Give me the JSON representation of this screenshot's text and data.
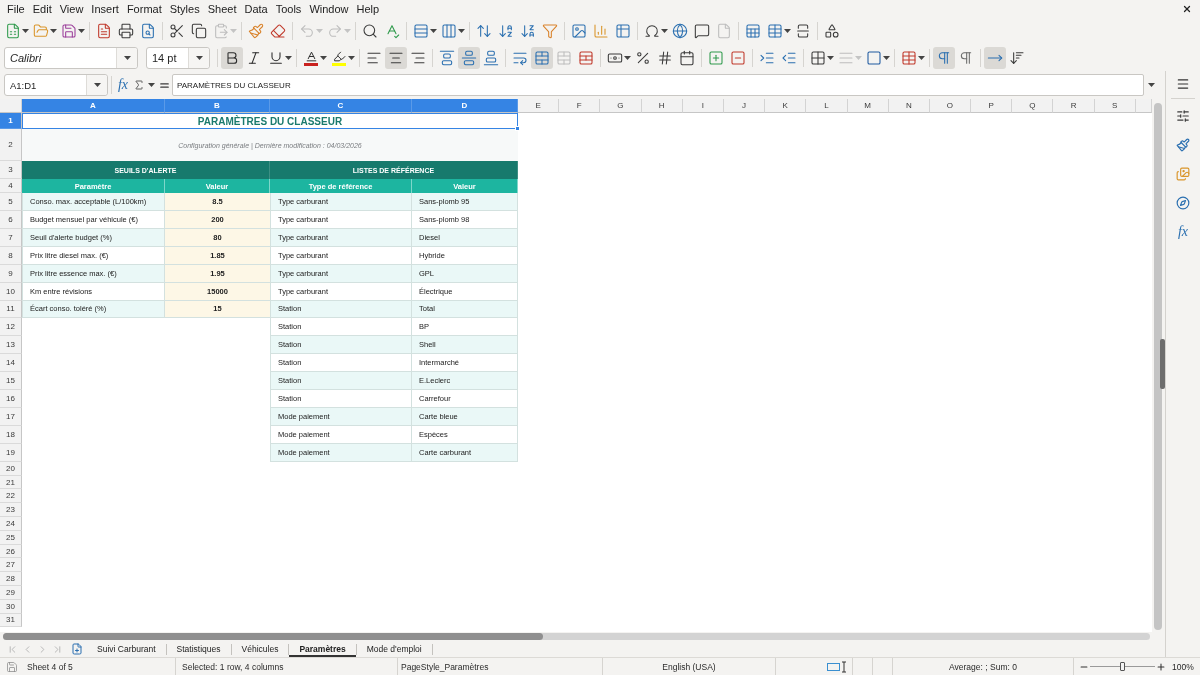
{
  "menu_bar": {
    "items": [
      "File",
      "Edit",
      "View",
      "Insert",
      "Format",
      "Styles",
      "Sheet",
      "Data",
      "Tools",
      "Window",
      "Help"
    ]
  },
  "standard_toolbar": {
    "groups": [
      {
        "buttons": [
          {
            "kind": "new",
            "disabled": false
          },
          {
            "kind": "open",
            "disabled": false
          },
          {
            "kind": "save",
            "disabled": false
          }
        ]
      },
      {
        "buttons": [
          {
            "kind": "pdf",
            "disabled": false
          },
          {
            "kind": "print",
            "disabled": false
          },
          {
            "kind": "preview",
            "disabled": false
          }
        ]
      },
      {
        "buttons": [
          {
            "kind": "cut",
            "disabled": false
          },
          {
            "kind": "copy",
            "disabled": false
          },
          {
            "kind": "paste",
            "disabled": true
          }
        ]
      },
      {
        "buttons": [
          {
            "kind": "brush",
            "disabled": false
          },
          {
            "kind": "eraser",
            "disabled": false
          }
        ]
      },
      {
        "buttons": [
          {
            "kind": "undo",
            "disabled": true
          },
          {
            "kind": "redo",
            "disabled": true
          }
        ]
      },
      {
        "buttons": [
          {
            "kind": "find",
            "disabled": false
          },
          {
            "kind": "spelling",
            "disabled": false
          }
        ]
      },
      {
        "buttons": [
          {
            "kind": "rows",
            "disabled": false
          },
          {
            "kind": "columns",
            "disabled": false
          }
        ]
      },
      {
        "buttons": [
          {
            "kind": "sort",
            "disabled": false
          },
          {
            "kind": "ascending",
            "disabled": false
          },
          {
            "kind": "descending",
            "disabled": false
          },
          {
            "kind": "filter",
            "disabled": false
          }
        ]
      },
      {
        "buttons": [
          {
            "kind": "image",
            "disabled": false
          },
          {
            "kind": "chart",
            "disabled": false
          },
          {
            "kind": "pivot",
            "disabled": false
          }
        ]
      },
      {
        "buttons": [
          {
            "kind": "symbol",
            "disabled": false
          },
          {
            "kind": "link",
            "disabled": false
          },
          {
            "kind": "comment",
            "disabled": false
          },
          {
            "kind": "header",
            "disabled": true
          }
        ]
      },
      {
        "buttons": [
          {
            "kind": "printarea",
            "disabled": false
          },
          {
            "kind": "freeze",
            "disabled": false
          },
          {
            "kind": "split",
            "disabled": false
          }
        ]
      },
      {
        "buttons": [
          {
            "kind": "shapes",
            "disabled": false
          }
        ]
      }
    ]
  },
  "format_toolbar": {
    "font_name": "Calibri",
    "font_size": "14 pt",
    "groups": [
      {
        "buttons": [
          {
            "kind": "bold",
            "pressed": true,
            "disabled": false
          },
          {
            "kind": "italic",
            "pressed": false,
            "disabled": false
          },
          {
            "kind": "underline",
            "pressed": false,
            "disabled": false
          }
        ]
      },
      {
        "buttons": [
          {
            "kind": "fontcolor",
            "pressed": false,
            "disabled": false
          },
          {
            "kind": "highlight",
            "pressed": false,
            "disabled": false
          }
        ]
      },
      {
        "buttons": [
          {
            "kind": "alignleft",
            "pressed": false,
            "disabled": false
          },
          {
            "kind": "aligncenter",
            "pressed": true,
            "disabled": false
          },
          {
            "kind": "alignright",
            "pressed": false,
            "disabled": false
          }
        ]
      },
      {
        "buttons": [
          {
            "kind": "aligntop",
            "pressed": false,
            "disabled": false
          },
          {
            "kind": "alignmiddle",
            "pressed": true,
            "disabled": false
          },
          {
            "kind": "alignbottom",
            "pressed": false,
            "disabled": false
          }
        ]
      },
      {
        "buttons": [
          {
            "kind": "wrap",
            "pressed": false,
            "disabled": false
          },
          {
            "kind": "mergecenter",
            "pressed": true,
            "disabled": false
          },
          {
            "kind": "merge",
            "pressed": false,
            "disabled": true
          },
          {
            "kind": "unmerge",
            "pressed": false,
            "disabled": false
          }
        ]
      },
      {
        "buttons": [
          {
            "kind": "currency",
            "pressed": false,
            "disabled": false
          },
          {
            "kind": "percent",
            "pressed": false,
            "disabled": false
          },
          {
            "kind": "number",
            "pressed": false,
            "disabled": false
          },
          {
            "kind": "date",
            "pressed": false,
            "disabled": false
          }
        ]
      },
      {
        "buttons": [
          {
            "kind": "adddecimal",
            "pressed": false,
            "disabled": false
          },
          {
            "kind": "deldecimal",
            "pressed": false,
            "disabled": false
          }
        ]
      },
      {
        "buttons": [
          {
            "kind": "indent",
            "pressed": false,
            "disabled": false
          },
          {
            "kind": "outdent",
            "pressed": false,
            "disabled": false
          }
        ]
      },
      {
        "buttons": [
          {
            "kind": "borders",
            "pressed": false,
            "disabled": false
          },
          {
            "kind": "borderstyle",
            "pressed": false,
            "disabled": true
          },
          {
            "kind": "bordercolor",
            "pressed": false,
            "disabled": false
          }
        ]
      },
      {
        "buttons": [
          {
            "kind": "conditional",
            "pressed": false,
            "disabled": false
          }
        ]
      },
      {
        "buttons": [
          {
            "kind": "ltr",
            "pressed": true,
            "disabled": false
          },
          {
            "kind": "rtl",
            "pressed": false,
            "disabled": false
          }
        ]
      },
      {
        "buttons": [
          {
            "kind": "horizontal",
            "pressed": true,
            "disabled": false
          },
          {
            "kind": "vertical",
            "pressed": false,
            "disabled": false
          }
        ]
      }
    ]
  },
  "formula_bar": {
    "name_box": "A1:D1",
    "function_wizard": "fx",
    "content": "PARAMÈTRES DU CLASSEUR"
  },
  "sidebar": {
    "functions": "fx"
  },
  "sheet": {
    "column_headers": [
      {
        "label": "A",
        "selected": true
      },
      {
        "label": "B",
        "selected": true
      },
      {
        "label": "C",
        "selected": true
      },
      {
        "label": "D",
        "selected": true
      },
      {
        "label": "E",
        "selected": false
      },
      {
        "label": "F",
        "selected": false
      },
      {
        "label": "G",
        "selected": false
      },
      {
        "label": "H",
        "selected": false
      },
      {
        "label": "I",
        "selected": false
      },
      {
        "label": "J",
        "selected": false
      },
      {
        "label": "K",
        "selected": false
      },
      {
        "label": "L",
        "selected": false
      },
      {
        "label": "M",
        "selected": false
      },
      {
        "label": "N",
        "selected": false
      },
      {
        "label": "O",
        "selected": false
      },
      {
        "label": "P",
        "selected": false
      },
      {
        "label": "Q",
        "selected": false
      },
      {
        "label": "R",
        "selected": false
      },
      {
        "label": "S",
        "selected": false
      }
    ],
    "row_headers": [
      {
        "label": "1",
        "selected": true
      },
      {
        "label": "2",
        "selected": false
      },
      {
        "label": "3",
        "selected": false
      },
      {
        "label": "4",
        "selected": false
      },
      {
        "label": "5",
        "selected": false
      },
      {
        "label": "6",
        "selected": false
      },
      {
        "label": "7",
        "selected": false
      },
      {
        "label": "8",
        "selected": false
      },
      {
        "label": "9",
        "selected": false
      },
      {
        "label": "10",
        "selected": false
      },
      {
        "label": "11",
        "selected": false
      },
      {
        "label": "12",
        "selected": false
      },
      {
        "label": "13",
        "selected": false
      },
      {
        "label": "14",
        "selected": false
      },
      {
        "label": "15",
        "selected": false
      },
      {
        "label": "16",
        "selected": false
      },
      {
        "label": "17",
        "selected": false
      },
      {
        "label": "18",
        "selected": false
      },
      {
        "label": "19",
        "selected": false
      },
      {
        "label": "20",
        "selected": false
      },
      {
        "label": "21",
        "selected": false
      },
      {
        "label": "22",
        "selected": false
      },
      {
        "label": "23",
        "selected": false
      },
      {
        "label": "24",
        "selected": false
      },
      {
        "label": "25",
        "selected": false
      },
      {
        "label": "26",
        "selected": false
      },
      {
        "label": "27",
        "selected": false
      },
      {
        "label": "28",
        "selected": false
      },
      {
        "label": "29",
        "selected": false
      },
      {
        "label": "30",
        "selected": false
      },
      {
        "label": "31",
        "selected": false
      }
    ],
    "title": {
      "text": "PARAMÈTRES DU CLASSEUR",
      "selected": true
    },
    "subtitle": "Configuration générale | Dernière modification : 04/03/2026",
    "alert_thresholds": {
      "heading": "SEUILS D'ALERTE",
      "columns": [
        "Paramètre",
        "Valeur"
      ],
      "rows": [
        {
          "parameter": "Conso. max. acceptable (L/100km)",
          "value": "8.5"
        },
        {
          "parameter": "Budget mensuel par véhicule (€)",
          "value": "200"
        },
        {
          "parameter": "Seuil d'alerte budget (%)",
          "value": "80"
        },
        {
          "parameter": "Prix litre diesel max. (€)",
          "value": "1.85"
        },
        {
          "parameter": "Prix litre essence max. (€)",
          "value": "1.95"
        },
        {
          "parameter": "Km entre révisions",
          "value": "15000"
        },
        {
          "parameter": "Écart conso. toléré (%)",
          "value": "15"
        }
      ]
    },
    "reference_lists": {
      "heading": "LISTES DE RÉFÉRENCE",
      "columns": [
        "Type de référence",
        "Valeur"
      ],
      "rows": [
        {
          "type": "Type carburant",
          "value": "Sans-plomb 95"
        },
        {
          "type": "Type carburant",
          "value": "Sans-plomb 98"
        },
        {
          "type": "Type carburant",
          "value": "Diesel"
        },
        {
          "type": "Type carburant",
          "value": "Hybride"
        },
        {
          "type": "Type carburant",
          "value": "GPL"
        },
        {
          "type": "Type carburant",
          "value": "Électrique"
        },
        {
          "type": "Station",
          "value": "Total"
        },
        {
          "type": "Station",
          "value": "BP"
        },
        {
          "type": "Station",
          "value": "Shell"
        },
        {
          "type": "Station",
          "value": "Intermarché"
        },
        {
          "type": "Station",
          "value": "E.Leclerc"
        },
        {
          "type": "Station",
          "value": "Carrefour"
        },
        {
          "type": "Mode paiement",
          "value": "Carte bleue"
        },
        {
          "type": "Mode paiement",
          "value": "Espèces"
        },
        {
          "type": "Mode paiement",
          "value": "Carte carburant"
        }
      ]
    }
  },
  "sheet_tabs": [
    {
      "label": "Suivi Carburant",
      "selected": false
    },
    {
      "label": "Statistiques",
      "selected": false
    },
    {
      "label": "Véhicules",
      "selected": false
    },
    {
      "label": "Paramètres",
      "selected": true
    },
    {
      "label": "Mode d'emploi",
      "selected": false
    }
  ],
  "status_bar": {
    "sheet": "Sheet 4 of 5",
    "selection": "Selected: 1 row, 4 columns",
    "page_style": "PageStyle_Paramètres",
    "language": "English (USA)",
    "summary": "Average: ; Sum: 0",
    "zoom": {
      "reading": "100%",
      "level": 0.5
    }
  }
}
